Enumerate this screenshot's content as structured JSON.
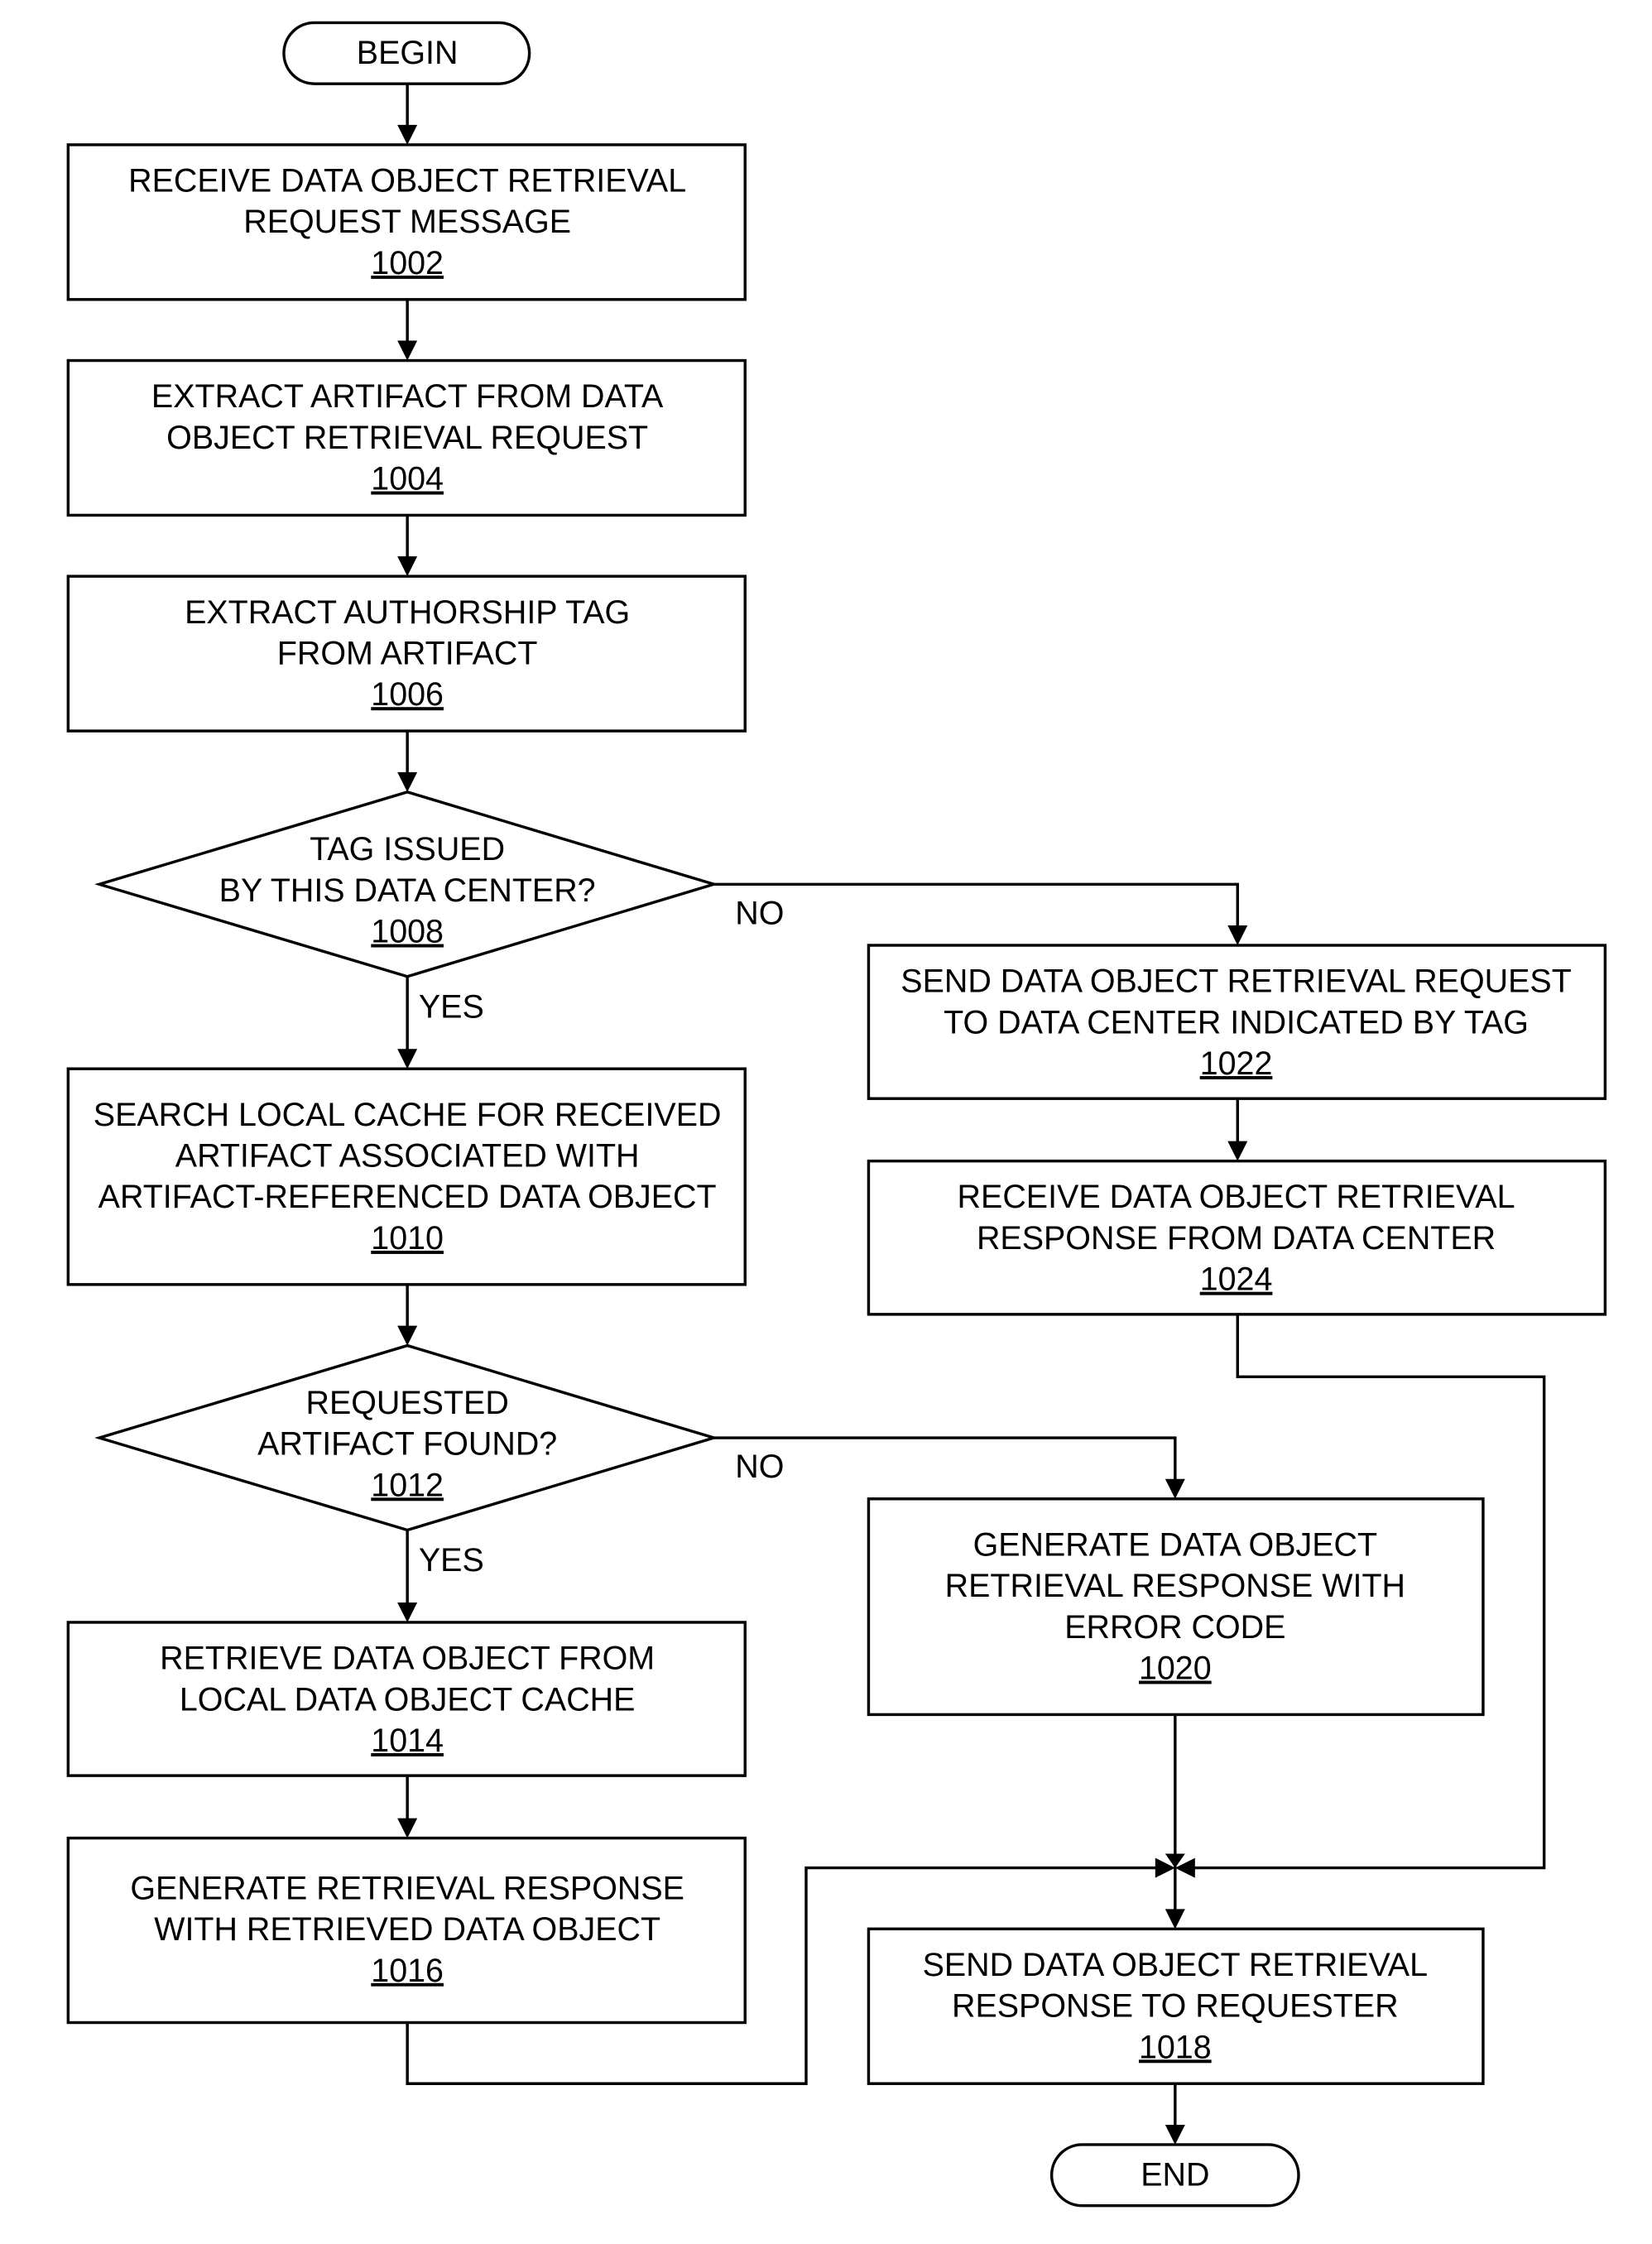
{
  "terminals": {
    "begin": "BEGIN",
    "end": "END"
  },
  "steps": {
    "s1002": {
      "lines": [
        "RECEIVE DATA OBJECT RETRIEVAL",
        "REQUEST MESSAGE"
      ],
      "ref": "1002"
    },
    "s1004": {
      "lines": [
        "EXTRACT ARTIFACT FROM DATA",
        "OBJECT RETRIEVAL REQUEST"
      ],
      "ref": "1004"
    },
    "s1006": {
      "lines": [
        "EXTRACT AUTHORSHIP TAG",
        "FROM ARTIFACT"
      ],
      "ref": "1006"
    },
    "s1008": {
      "lines": [
        "TAG ISSUED",
        "BY THIS DATA CENTER?"
      ],
      "ref": "1008"
    },
    "s1010": {
      "lines": [
        "SEARCH LOCAL CACHE FOR RECEIVED",
        "ARTIFACT ASSOCIATED WITH",
        "ARTIFACT-REFERENCED DATA OBJECT"
      ],
      "ref": "1010"
    },
    "s1012": {
      "lines": [
        "REQUESTED",
        "ARTIFACT FOUND?"
      ],
      "ref": "1012"
    },
    "s1014": {
      "lines": [
        "RETRIEVE DATA OBJECT FROM",
        "LOCAL DATA OBJECT CACHE"
      ],
      "ref": "1014"
    },
    "s1016": {
      "lines": [
        "GENERATE RETRIEVAL RESPONSE",
        "WITH RETRIEVED DATA OBJECT"
      ],
      "ref": "1016"
    },
    "s1018": {
      "lines": [
        "SEND DATA OBJECT RETRIEVAL",
        "RESPONSE TO REQUESTER"
      ],
      "ref": "1018"
    },
    "s1020": {
      "lines": [
        "GENERATE DATA OBJECT",
        "RETRIEVAL RESPONSE WITH",
        "ERROR CODE"
      ],
      "ref": "1020"
    },
    "s1022": {
      "lines": [
        "SEND DATA OBJECT RETRIEVAL REQUEST",
        "TO DATA CENTER INDICATED BY TAG"
      ],
      "ref": "1022"
    },
    "s1024": {
      "lines": [
        "RECEIVE DATA OBJECT RETRIEVAL",
        "RESPONSE FROM DATA CENTER"
      ],
      "ref": "1024"
    }
  },
  "branch_labels": {
    "d1008_no": "NO",
    "d1008_yes": "YES",
    "d1012_no": "NO",
    "d1012_yes": "YES"
  }
}
